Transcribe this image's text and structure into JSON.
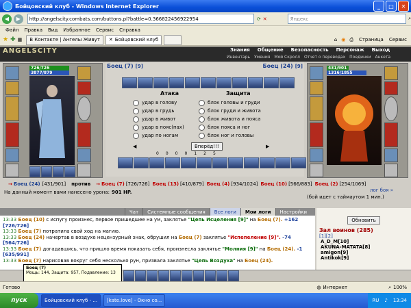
{
  "window": {
    "title": "Бойцовский клуб - Windows Internet Explorer",
    "url": "http://angelscity.combats.com/buttons.pl?battle=0.366822456922954",
    "search_placeholder": "Яндекс",
    "minimize": "_",
    "maximize": "□",
    "close": "✕"
  },
  "menu": [
    "Файл",
    "Правка",
    "Вид",
    "Избранное",
    "Сервис",
    "Справка"
  ],
  "tabs": {
    "items": [
      "В Контакте | Ангелы Живут",
      "Бойцовский клуб"
    ],
    "page_label": "Страница",
    "tools_label": "Сервис"
  },
  "game": {
    "logo": "ANGELSCITY",
    "nav": [
      "Знания",
      "Общение",
      "Безопасность",
      "Персонаж",
      "Выход"
    ],
    "subnav": [
      "Инвентарь",
      "Умения",
      "Мой Скролл",
      "Отчет о переводах",
      "Поединки",
      "Анкета"
    ],
    "left_fighter": {
      "hp": "726/726",
      "mana": "3877/879",
      "name": "Боец (7)"
    },
    "right_fighter": {
      "hp": "431/901",
      "mana": "1316/1855",
      "name": "Боец (24)"
    },
    "attack_title": "Атака",
    "defense_title": "Защита",
    "attacks": [
      "удар в голову",
      "удар в грудь",
      "удар в живот",
      "удар в пояс(пах)",
      "удар по ногам"
    ],
    "defenses": [
      "блок головы и груди",
      "блок груди и живота",
      "блок живота и пояса",
      "блок пояса и ног",
      "блок ног и головы"
    ],
    "forward_button": "Вперёд!!!",
    "stats": [
      "0",
      "0",
      "0",
      "0",
      "1",
      "2",
      "5"
    ]
  },
  "versus": {
    "left": "Боец (24)",
    "left_hp": "[431/901]",
    "vs": "против",
    "right": [
      {
        "name": "Боец (7)",
        "hp": "[726/726]"
      },
      {
        "name": "Боец (13)",
        "hp": "[410/879]"
      },
      {
        "name": "Боец (4)",
        "hp": "[934/1024]"
      },
      {
        "name": "Боец (10)",
        "hp": "[566/883]"
      },
      {
        "name": "Боец (2)",
        "hp": "[254/1069]"
      }
    ],
    "log_link": "лог боя »"
  },
  "damage": {
    "text": "На данный момент вами нанесено урона:",
    "value": "901 HP.",
    "timeout": "(бой идет с таймаутом 1 мин.)"
  },
  "log_tabs": [
    "Чат",
    "Системные сообщения",
    "Все логи",
    "Мои логи",
    "Настройки"
  ],
  "log": [
    {
      "time": "13:33",
      "who": "Боец (10)",
      "text": " с испугу произнес, первое пришедшее на ум, заклятье ",
      "spell": "\"Цепь Исцеления [9]\"",
      "to": " на ",
      "target": "Боец (7).",
      "num": " +162 [726/726]"
    },
    {
      "time": "13:33",
      "who": "Боец (7)",
      "text": " потратила свой ход на магию.",
      "spell": "",
      "to": "",
      "target": "",
      "num": ""
    },
    {
      "time": "13:33",
      "who": "Боец (24)",
      "text": " начертав в воздухе нецензурный знак, обрушил на ",
      "spell": "Боец (7)",
      "to": " заклятье ",
      "target": "\"Испепеление [9]\".",
      "num": " -74 [564/726]"
    },
    {
      "time": "13:33",
      "who": "Боец (7)",
      "text": " догадавшись, что пришло время показать себя, произнесла заклятье ",
      "spell": "\"Молния [9]\"",
      "to": " на ",
      "target": "Боец (24).",
      "num": " -1 [635/991]"
    },
    {
      "time": "13:33",
      "who": "Боец (7)",
      "text": " нарисовав вокруг себя несколько рун, призвала заклятье ",
      "spell": "\"Цепь Воздуха\"",
      "to": " на ",
      "target": "Боец (24).",
      "num": ""
    }
  ],
  "tooltip": {
    "title": "Боец (7)",
    "text": "Мощь: 144, Защита: 957, Подавление: 13"
  },
  "right_panel": {
    "refresh": "Обновить",
    "title": "Зал воинов (285)",
    "pages": "[1][2]",
    "players": [
      "A_D_M[10]",
      "AKUNA-MATATA[8]",
      "amigon[9]",
      "Antikok[9]"
    ]
  },
  "status": {
    "done": "Готово",
    "zone": "Интернет",
    "zoom": "100%"
  },
  "taskbar": {
    "start": "пуск",
    "tasks": [
      "Бойцовский клуб - ...",
      "[kate.love] - Окно со..."
    ],
    "lang": "RU",
    "clock": "13:34"
  }
}
